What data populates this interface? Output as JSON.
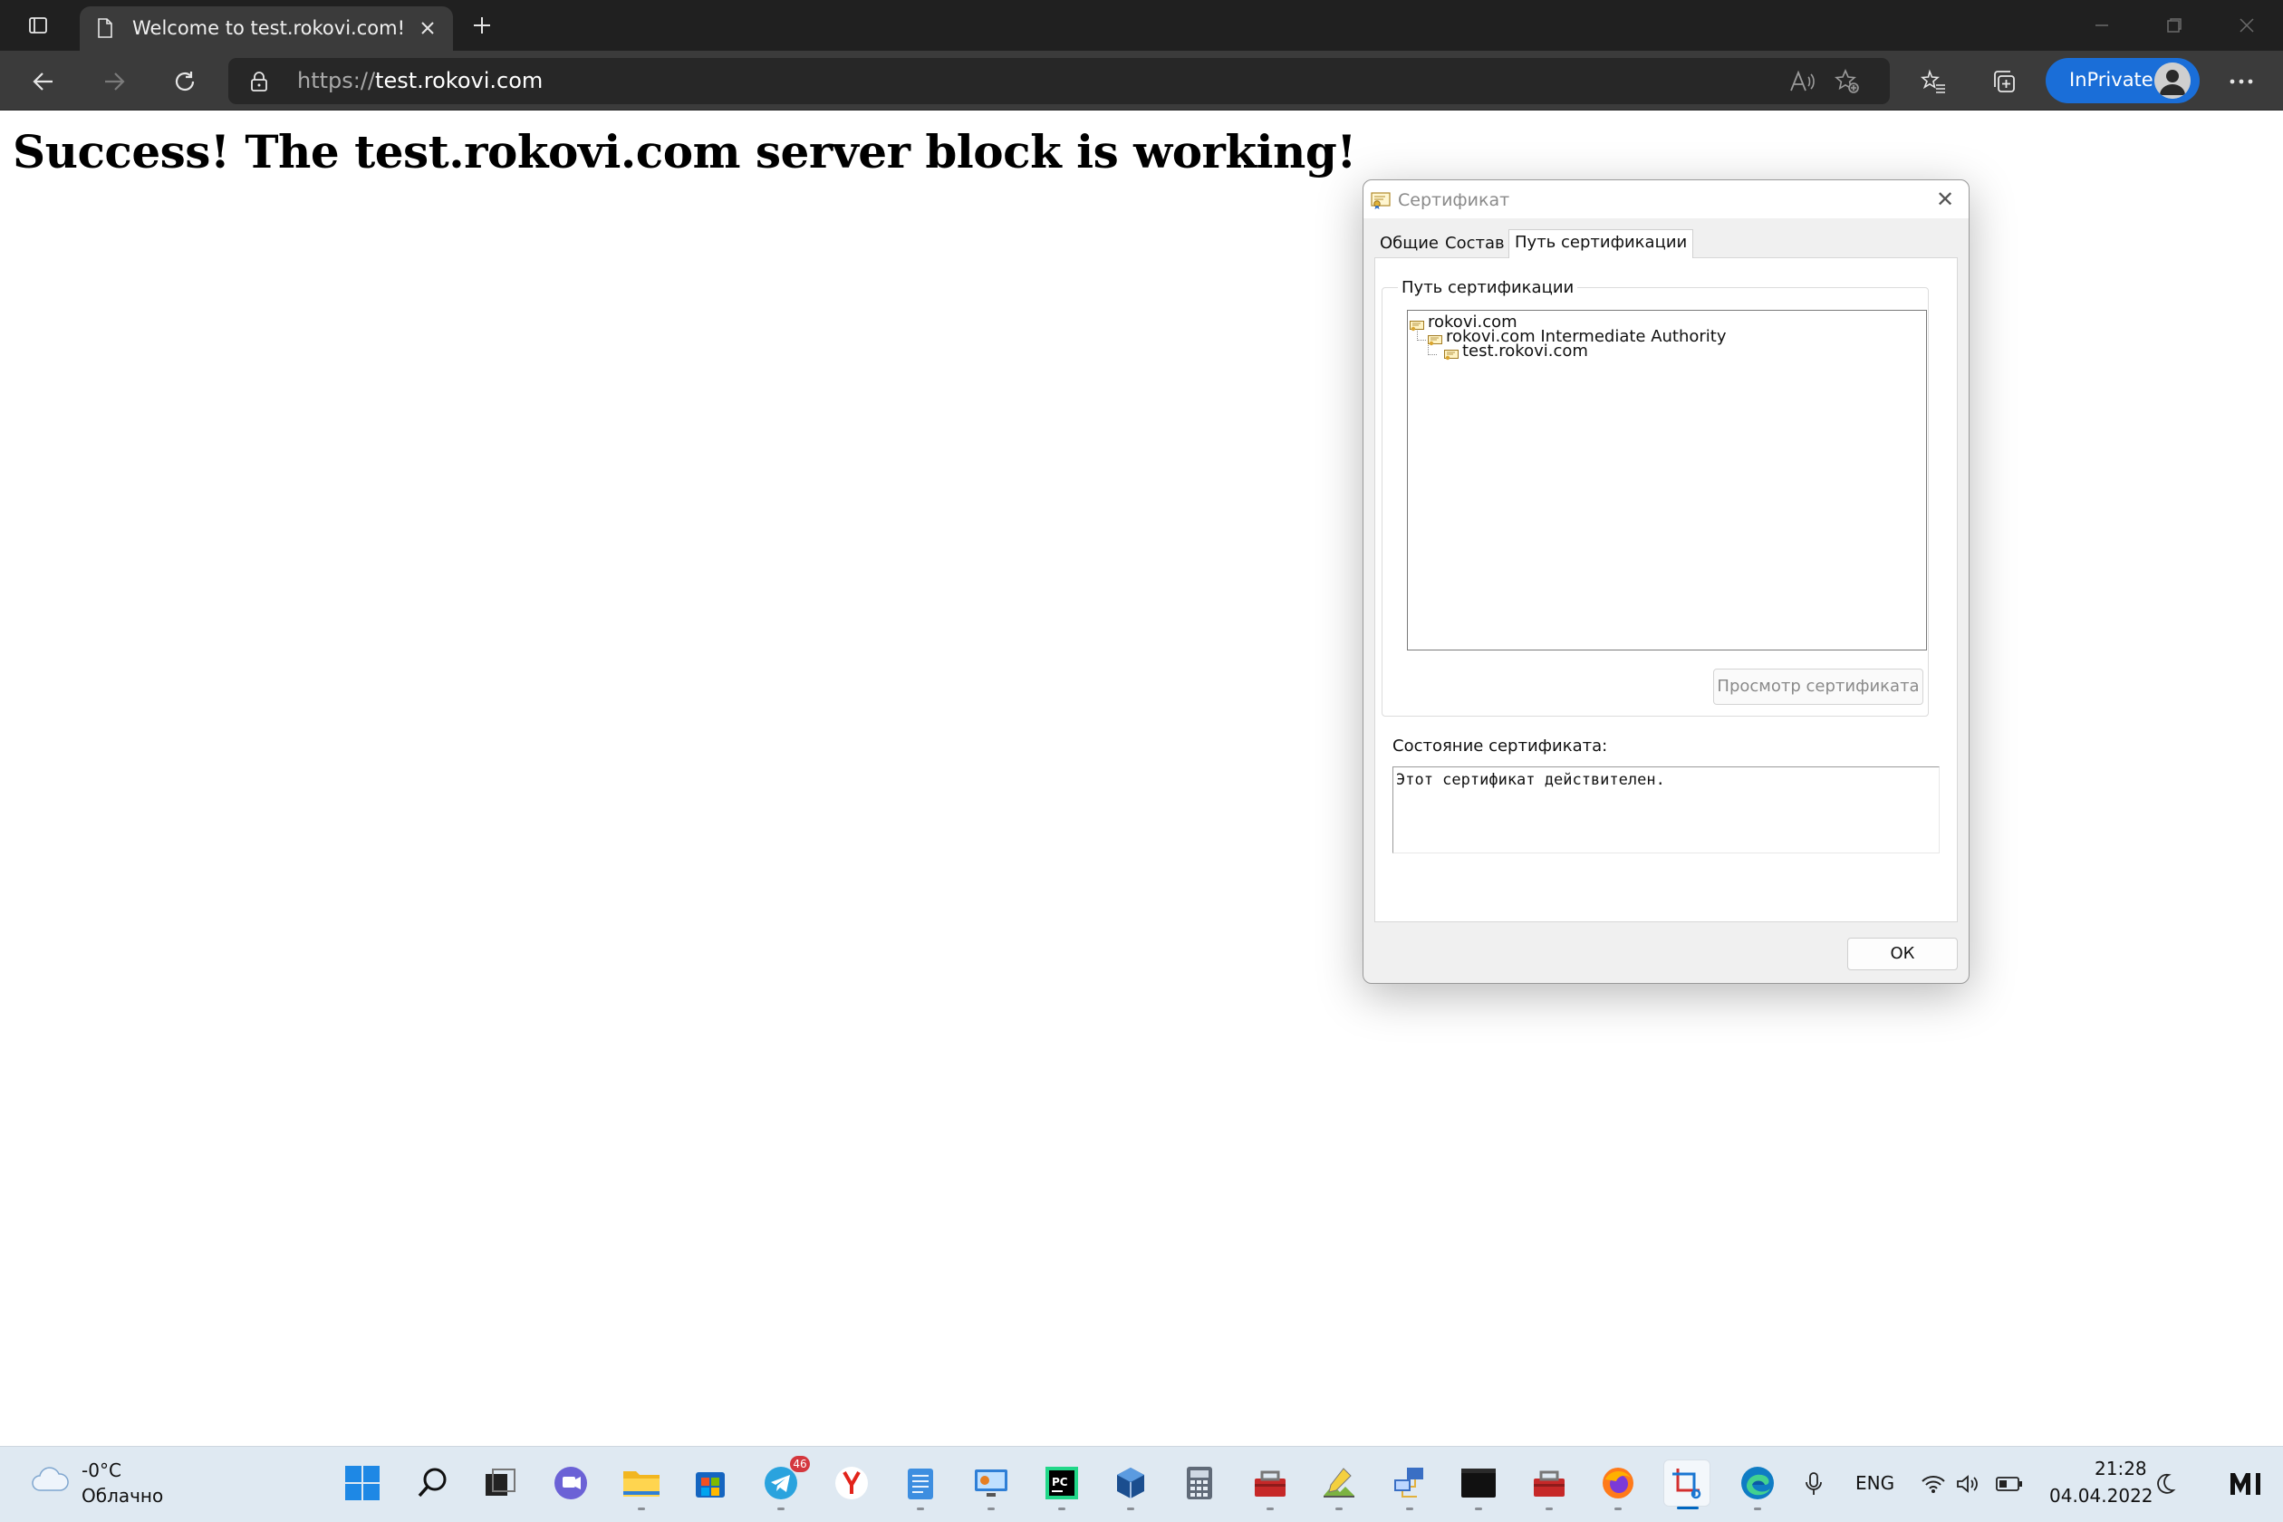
{
  "browser": {
    "tab_title": "Welcome to test.rokovi.com!",
    "address_scheme": "https://",
    "address_host": "test.rokovi.com",
    "inprivate_label": "InPrivate"
  },
  "page": {
    "heading": "Success! The test.rokovi.com server block is working!"
  },
  "cert_dialog": {
    "title": "Сертификат",
    "tabs": [
      "Общие",
      "Состав",
      "Путь сертификации"
    ],
    "active_tab": "Путь сертификации",
    "path_group_label": "Путь сертификации",
    "path_tree": [
      {
        "label": "rokovi.com",
        "level": 0
      },
      {
        "label": "rokovi.com Intermediate Authority",
        "level": 1
      },
      {
        "label": "test.rokovi.com",
        "level": 2
      }
    ],
    "view_cert_button": "Просмотр сертификата",
    "status_label": "Состояние сертификата:",
    "status_text": "Этот сертификат действителен.",
    "ok_button": "ОК"
  },
  "taskbar": {
    "weather_temp": "-0°C",
    "weather_desc": "Облачно",
    "telegram_badge": "46",
    "language": "ENG",
    "time": "21:28",
    "date": "04.04.2022"
  },
  "colors": {
    "inprivate_accent": "#1a6ed8",
    "taskbar_bg": "#dfe9f2",
    "dialog_bg": "#f0f0f0"
  }
}
